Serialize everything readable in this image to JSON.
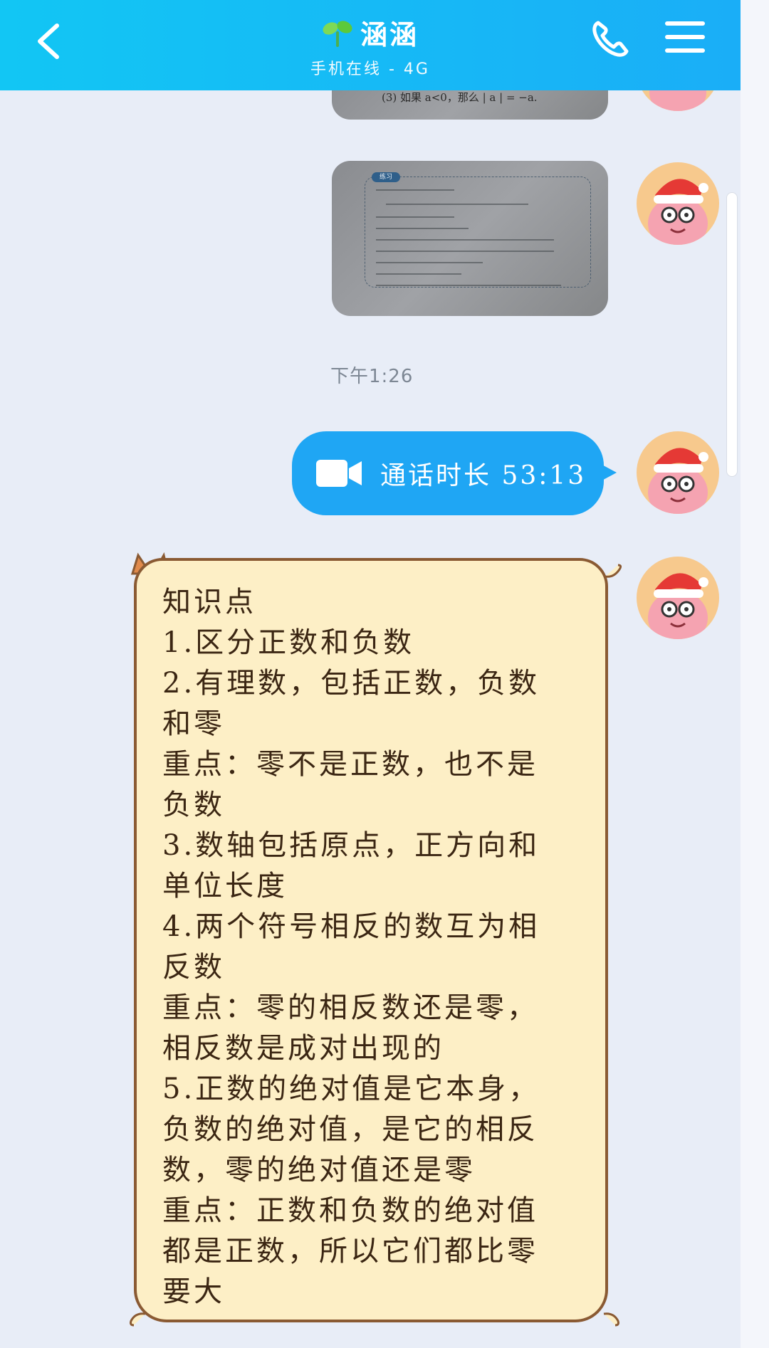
{
  "header": {
    "title": "涵涵",
    "subtitle": "手机在线 - 4G"
  },
  "messages": {
    "image1_formula": "(3) 如果 a<0，那么 | a | = −a.",
    "timestamp": "下午1:26",
    "call": {
      "text": "通话时长 53:13"
    },
    "note": {
      "lines": [
        "知识点",
        "1.区分正数和负数",
        "2.有理数，包括正数，负数",
        "和零",
        "重点：零不是正数，也不是",
        "负数",
        "3.数轴包括原点，正方向和",
        "单位长度",
        "4.两个符号相反的数互为相",
        "反数",
        "重点：零的相反数还是零，",
        "相反数是成对出现的",
        "5.正数的绝对值是它本身，",
        "负数的绝对值，是它的相反",
        "数，零的绝对值还是零",
        "重点：正数和负数的绝对值",
        "都是正数，所以它们都比零",
        "要大"
      ]
    }
  },
  "colors": {
    "header": "#1aaef7",
    "call_bubble": "#1fa6f4",
    "note_bg": "#fdefc6",
    "note_border": "#8a5a33",
    "background": "#e8edf7"
  },
  "icons": {
    "back": "chevron-left-icon",
    "phone": "phone-icon",
    "menu": "menu-icon",
    "video": "video-camera-icon",
    "sprout": "sprout-icon"
  }
}
